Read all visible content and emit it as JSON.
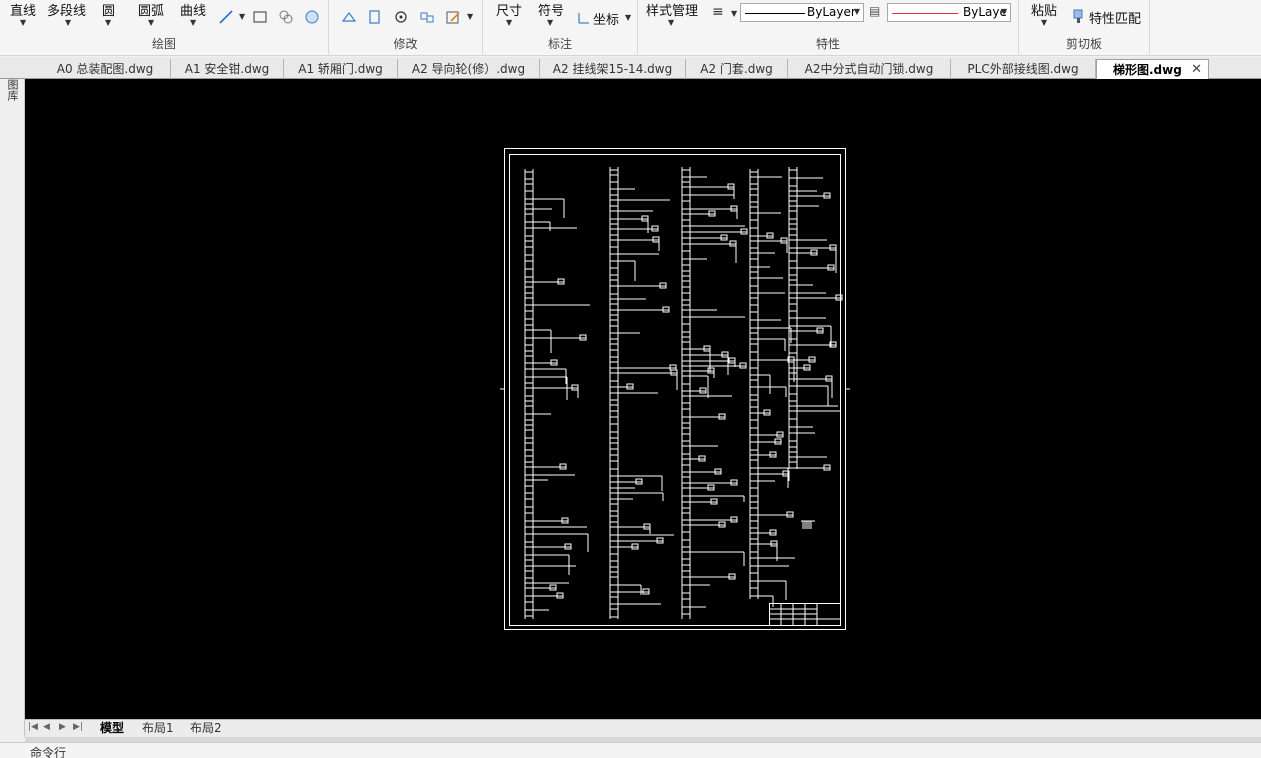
{
  "ribbon": {
    "draw": {
      "line": "直线",
      "polyline": "多段线",
      "circle": "圆",
      "arc": "圆弧",
      "curve": "曲线",
      "label": "绘图"
    },
    "modify": {
      "label": "修改"
    },
    "annotate": {
      "dimension": "尺寸",
      "symbol": "符号",
      "coordinate": "坐标",
      "label": "标注"
    },
    "properties": {
      "style_manager": "样式管理",
      "linetype_value": "ByLayer",
      "color_value": "ByLaye",
      "label": "特性"
    },
    "clipboard": {
      "paste": "粘贴",
      "match_properties": "特性匹配",
      "label": "剪切板"
    }
  },
  "doc_tabs": [
    "A0 总装配图.dwg",
    "A1 安全钳.dwg",
    "A1 轿厢门.dwg",
    "A2 导向轮(修）.dwg",
    "A2 挂线架15-14.dwg",
    "A2 门套.dwg",
    "A2中分式自动门锁.dwg",
    "PLC外部接线图.dwg",
    "梯形图.dwg"
  ],
  "active_tab_index": 8,
  "left_panel_label": "图库",
  "layout_tabs": [
    "模型",
    "布局1",
    "布局2"
  ],
  "active_layout_index": 0,
  "command_line_label": "命令行",
  "colors": {
    "canvas_bg": "#000000",
    "drawing_line": "#ffffff",
    "ribbon_bg": "#f5f5f5",
    "color_swatch": "#e03030"
  },
  "icons": {
    "line_dropdown": "slash-line-icon",
    "rect": "rectangle-icon",
    "hatch": "hatch-icon",
    "circle": "circle-icon",
    "copy": "copy-icon",
    "match": "brush-icon"
  }
}
